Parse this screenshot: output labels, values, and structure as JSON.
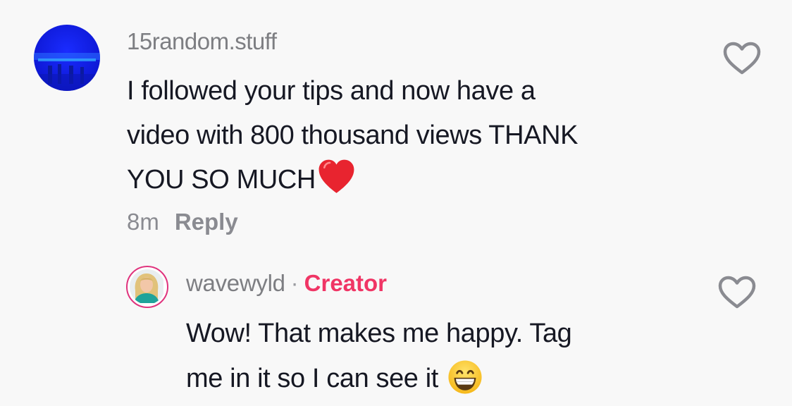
{
  "comment": {
    "username": "15random.stuff",
    "avatar_icon": "blue-photo-avatar",
    "text_lines": [
      "I followed your tips and now have a",
      "video with 800 thousand views THANK",
      "YOU SO MUCH"
    ],
    "trailing_emoji": "red-heart-emoji",
    "time": "8m",
    "reply_label": "Reply",
    "like_icon": "heart-outline-icon"
  },
  "reply": {
    "username": "wavewyld",
    "separator": "·",
    "badge": "Creator",
    "badge_color": "#f03565",
    "avatar_ring_color": "#e0337d",
    "text_lines": [
      "Wow! That makes me happy. Tag",
      "me in it so I can see it"
    ],
    "trailing_emoji": "grinning-face-emoji",
    "like_icon": "heart-outline-icon"
  }
}
